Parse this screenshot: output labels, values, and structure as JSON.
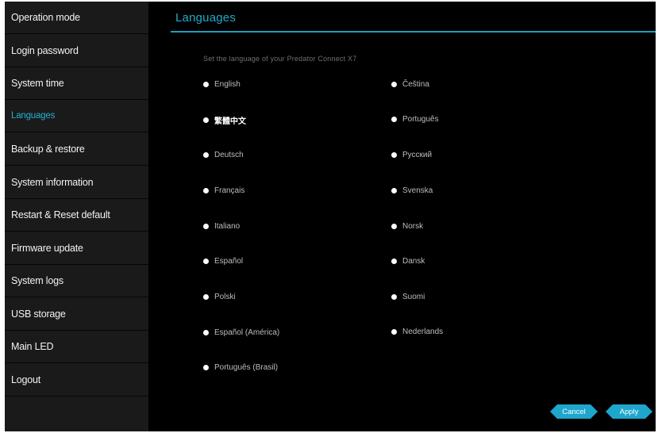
{
  "sidebar": {
    "items": [
      {
        "label": "Operation mode"
      },
      {
        "label": "Login password"
      },
      {
        "label": "System time"
      },
      {
        "label": "Languages",
        "active": true
      },
      {
        "label": "Backup & restore"
      },
      {
        "label": "System information"
      },
      {
        "label": "Restart & Reset default"
      },
      {
        "label": "Firmware update"
      },
      {
        "label": "System logs"
      },
      {
        "label": "USB storage"
      },
      {
        "label": "Main LED"
      },
      {
        "label": "Logout"
      }
    ]
  },
  "main": {
    "title": "Languages",
    "subtitle": "Set the language of your Predator Connect X7",
    "languages_left": [
      "English",
      "繁體中文",
      "Deutsch",
      "Français",
      "Italiano",
      "Español",
      "Polski",
      "Español (América)",
      "Português (Brasil)"
    ],
    "languages_right": [
      "Čeština",
      "Português",
      "Русский",
      "Svenska",
      "Norsk",
      "Dansk",
      "Suomi",
      "Nederlands"
    ],
    "selected_language": "繁體中文"
  },
  "buttons": {
    "cancel": "Cancel",
    "apply": "Apply"
  },
  "colors": {
    "accent": "#1ea6cc",
    "background": "#000000",
    "sidebar": "#1a1a1a"
  }
}
